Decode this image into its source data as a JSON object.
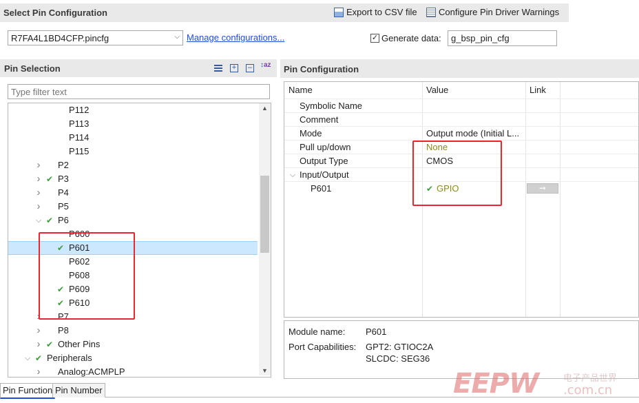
{
  "header": {
    "title": "Select Pin Configuration",
    "export_csv": "Export to CSV file",
    "configure_warnings": "Configure Pin Driver Warnings"
  },
  "config_bar": {
    "selected_config": "R7FA4L1BD4CFP.pincfg",
    "manage_link": "Manage configurations...",
    "generate_label": "Generate data:",
    "generate_checked": true,
    "generate_value": "g_bsp_pin_cfg"
  },
  "pin_selection": {
    "title": "Pin Selection",
    "filter_placeholder": "Type filter text",
    "items": [
      {
        "label": "P112",
        "level": 3,
        "expand": "",
        "check": false
      },
      {
        "label": "P113",
        "level": 3,
        "expand": "",
        "check": false
      },
      {
        "label": "P114",
        "level": 3,
        "expand": "",
        "check": false
      },
      {
        "label": "P115",
        "level": 3,
        "expand": "",
        "check": false
      },
      {
        "label": "P2",
        "level": 2,
        "expand": "collapsed",
        "check": false
      },
      {
        "label": "P3",
        "level": 2,
        "expand": "collapsed",
        "check": true
      },
      {
        "label": "P4",
        "level": 2,
        "expand": "collapsed",
        "check": false
      },
      {
        "label": "P5",
        "level": 2,
        "expand": "collapsed",
        "check": false
      },
      {
        "label": "P6",
        "level": 2,
        "expand": "expanded",
        "check": true
      },
      {
        "label": "P600",
        "level": 3,
        "expand": "",
        "check": false
      },
      {
        "label": "P601",
        "level": 3,
        "expand": "",
        "check": true,
        "selected": true
      },
      {
        "label": "P602",
        "level": 3,
        "expand": "",
        "check": false
      },
      {
        "label": "P608",
        "level": 3,
        "expand": "",
        "check": false
      },
      {
        "label": "P609",
        "level": 3,
        "expand": "",
        "check": true
      },
      {
        "label": "P610",
        "level": 3,
        "expand": "",
        "check": true
      },
      {
        "label": "P7",
        "level": 2,
        "expand": "collapsed",
        "check": false
      },
      {
        "label": "P8",
        "level": 2,
        "expand": "collapsed",
        "check": false
      },
      {
        "label": "Other Pins",
        "level": 2,
        "expand": "collapsed",
        "check": true
      },
      {
        "label": "Peripherals",
        "level": 1,
        "expand": "expanded",
        "check": true
      },
      {
        "label": "Analog:ACMPLP",
        "level": 2,
        "expand": "collapsed",
        "check": false
      }
    ]
  },
  "pin_config": {
    "title": "Pin Configuration",
    "columns": [
      "Name",
      "Value",
      "Link"
    ],
    "rows": [
      {
        "name": "Symbolic Name",
        "value": "",
        "indent": 1,
        "expand": "",
        "check": false,
        "value_color": "#1f1f1f"
      },
      {
        "name": "Comment",
        "value": "",
        "indent": 1,
        "expand": "",
        "check": false,
        "value_color": "#1f1f1f"
      },
      {
        "name": "Mode",
        "value": "Output mode (Initial L...",
        "indent": 1,
        "expand": "",
        "check": false,
        "value_color": "#1f1f1f"
      },
      {
        "name": "Pull up/down",
        "value": "None",
        "indent": 1,
        "expand": "",
        "check": false,
        "value_color": "#8a8a1a"
      },
      {
        "name": "Output Type",
        "value": "CMOS",
        "indent": 1,
        "expand": "",
        "check": false,
        "value_color": "#1f1f1f"
      },
      {
        "name": "Input/Output",
        "value": "",
        "indent": 1,
        "expand": "expanded",
        "check": false,
        "value_color": "#1f1f1f"
      },
      {
        "name": "P601",
        "value": "GPIO",
        "indent": 2,
        "expand": "",
        "check": true,
        "value_color": "#8a8a1a",
        "link": true
      }
    ],
    "module_label": "Module name:",
    "module_value": "P601",
    "capabilities_label": "Port Capabilities:",
    "capabilities": [
      "GPT2: GTIOC2A",
      "SLCDC: SEG36"
    ]
  },
  "bottom_tabs": [
    "Pin Function",
    "Pin Number"
  ],
  "watermark": {
    "brand": "EEPW",
    "site": ".com.cn",
    "cn": "电子产品世界"
  },
  "colors": {
    "accent_link": "#1c4fd8",
    "check": "#3d9b3d",
    "annotation": "#e8262c",
    "selection": "#cce8ff"
  }
}
